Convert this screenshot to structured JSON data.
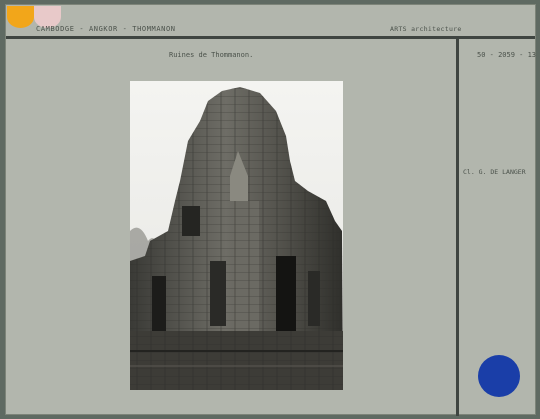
{
  "header": {
    "location": "CAMBODGE - ANGKOR - THOMMANON",
    "category": "ARTS architecture"
  },
  "caption": "Ruines de Thommanon.",
  "reference": "50 - 2059 - 13",
  "credit": "Cl. G. DE LANGER",
  "colors": {
    "card": "#b2b6ad",
    "rule": "#3f4541",
    "orange_sticker": "#f2a61a",
    "pink_sticker": "#e8c9c9",
    "blue_sticker": "#1a3ea8"
  }
}
